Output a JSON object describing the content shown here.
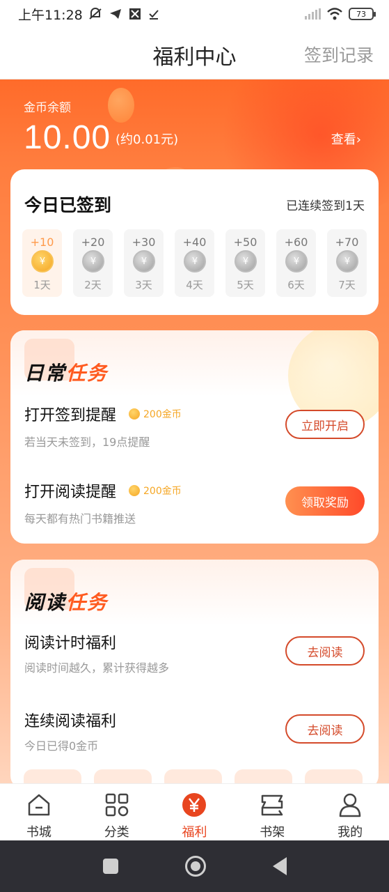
{
  "status_bar": {
    "time": "上午11:28",
    "battery": "73"
  },
  "header": {
    "title": "福利中心",
    "record_link": "签到记录"
  },
  "balance": {
    "label": "金币余额",
    "value": "10.00",
    "approx": "(约0.01元)",
    "view_link": "查看›"
  },
  "signin": {
    "title": "今日已签到",
    "streak": "已连续签到1天",
    "days": [
      {
        "points": "+10",
        "label": "1天",
        "active": true
      },
      {
        "points": "+20",
        "label": "2天",
        "active": false
      },
      {
        "points": "+30",
        "label": "3天",
        "active": false
      },
      {
        "points": "+40",
        "label": "4天",
        "active": false
      },
      {
        "points": "+50",
        "label": "5天",
        "active": false
      },
      {
        "points": "+60",
        "label": "6天",
        "active": false
      },
      {
        "points": "+70",
        "label": "7天",
        "active": false
      }
    ],
    "coin_symbol": "¥"
  },
  "daily_tasks": {
    "title_part1": "日常",
    "title_part2": "任务",
    "items": [
      {
        "name": "打开签到提醒",
        "reward": "200金币",
        "desc": "若当天未签到，19点提醒",
        "button": "立即开启",
        "style": "outline"
      },
      {
        "name": "打开阅读提醒",
        "reward": "200金币",
        "desc": "每天都有热门书籍推送",
        "button": "领取奖励",
        "style": "filled"
      }
    ]
  },
  "reading_tasks": {
    "title_part1": "阅读",
    "title_part2": "任务",
    "items": [
      {
        "name": "阅读计时福利",
        "desc": "阅读时间越久，累计获得越多",
        "button": "去阅读"
      },
      {
        "name": "连续阅读福利",
        "desc": "今日已得0金币",
        "button": "去阅读"
      }
    ]
  },
  "bottom_nav": [
    {
      "label": "书城",
      "icon": "home-icon",
      "active": false
    },
    {
      "label": "分类",
      "icon": "grid-icon",
      "active": false
    },
    {
      "label": "福利",
      "icon": "yen-icon",
      "active": true
    },
    {
      "label": "书架",
      "icon": "bookshelf-icon",
      "active": false
    },
    {
      "label": "我的",
      "icon": "user-icon",
      "active": false
    }
  ],
  "colors": {
    "accent": "#e8451f",
    "hero_top": "#ff6b2a",
    "gold": "#f5a623"
  }
}
